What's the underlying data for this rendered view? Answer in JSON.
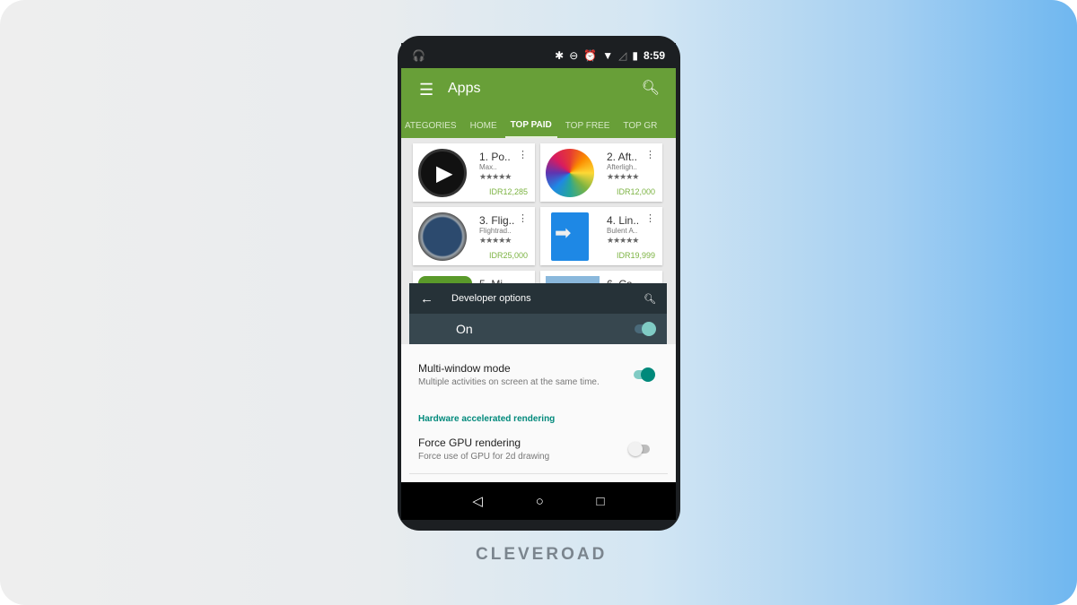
{
  "status_bar": {
    "time": "8:59",
    "icons": [
      "headphones-icon",
      "bluetooth-icon",
      "dnd-icon",
      "alarm-icon",
      "wifi-icon",
      "signal-icon",
      "battery-icon"
    ]
  },
  "appbar": {
    "title": "Apps",
    "tabs": [
      "ATEGORIES",
      "HOME",
      "TOP PAID",
      "TOP FREE",
      "TOP GR"
    ],
    "active_tab": "TOP PAID",
    "color": "#689f38"
  },
  "apps": [
    {
      "name": "1. Po..",
      "dev": "Max..",
      "price": "IDR12,285",
      "stars": "★★★★★"
    },
    {
      "name": "2. Aft..",
      "dev": "Afterligh..",
      "price": "IDR12,000",
      "stars": "★★★★★"
    },
    {
      "name": "3. Flig..",
      "dev": "Flightrad..",
      "price": "IDR25,000",
      "stars": "★★★★★"
    },
    {
      "name": "4. Lin..",
      "dev": "Bulent A..",
      "price": "IDR19,999",
      "stars": "★★★★★"
    },
    {
      "name": "5. Mi"
    },
    {
      "name": "6. Ca"
    }
  ],
  "developer": {
    "title": "Developer options",
    "master_label": "On",
    "master_on": true,
    "multi_window": {
      "title": "Multi-window mode",
      "summary": "Multiple activities on screen at the same time.",
      "on": true
    },
    "section": "Hardware accelerated rendering",
    "force_gpu": {
      "title": "Force GPU rendering",
      "summary": "Force use of GPU for 2d drawing",
      "on": false
    },
    "accent": "#00897b"
  },
  "nav": {
    "back": "◁",
    "home": "○",
    "recents": "□"
  },
  "brand": "CLEVEROAD"
}
